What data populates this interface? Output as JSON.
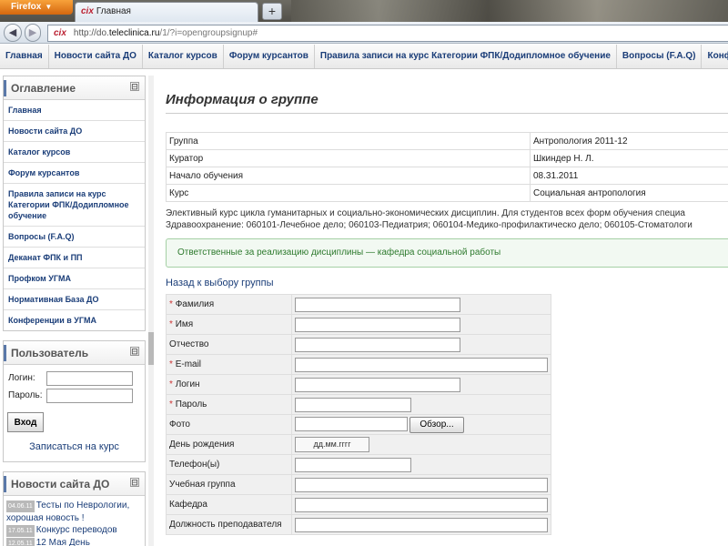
{
  "browser": {
    "app_button": "Firefox",
    "tab_logo": "cix",
    "tab_title": "Главная",
    "new_tab": "+",
    "url": {
      "scheme": "http://do.",
      "domain": "teleclinica.ru",
      "path": "/1/?i=opengroupsignup#"
    },
    "site_id": "cix",
    "back": "◀",
    "forward": "▶"
  },
  "topmenu": [
    "Главная",
    "Новости сайта ДО",
    "Каталог курсов",
    "Форум курсантов",
    "Правила записи на курс Категории ФПК/Додипломное обучение",
    "Вопросы (F.A.Q)",
    "Конференции в УГМА"
  ],
  "sidebar": {
    "toc_title": "Оглавление",
    "collapse_symbol": "⊟",
    "toc_items": [
      "Главная",
      "Новости сайта ДО",
      "Каталог курсов",
      "Форум курсантов",
      "Правила записи на курс Категории ФПК/Додипломное обучение",
      "Вопросы (F.A.Q)",
      "Деканат ФПК и ПП",
      "Профком УГМА",
      "Нормативная База ДО",
      "Конференции в УГМА"
    ],
    "user_title": "Пользователь",
    "login_label": "Логин:",
    "password_label": "Пароль:",
    "login_button": "Вход",
    "enroll_link": "Записаться на курс",
    "news_title": "Новости сайта ДО",
    "news": [
      {
        "date": "04.06.11",
        "text": "Тесты по Неврологии, хорошая новость !"
      },
      {
        "date": "17.05.11",
        "text": "Конкурс переводов"
      },
      {
        "date": "12.05.11",
        "text": "12 Мая День"
      }
    ]
  },
  "main": {
    "title": "Информация о группе",
    "info": [
      {
        "key": "Группа",
        "value": "Антропология 2011-12"
      },
      {
        "key": "Куратор",
        "value": "Шкиндер Н. Л."
      },
      {
        "key": "Начало обучения",
        "value": "08.31.2011"
      },
      {
        "key": "Курс",
        "value": "Социальная антропология"
      }
    ],
    "desc_line1": "Элективный курс цикла гуманитарных и социально-экономических дисциплин. Для студентов всех форм обучения специа",
    "desc_line2": "Здравоохранение: 060101-Лечебное дело; 060103-Педиатрия; 060104-Медико-профилактическо дело; 060105-Стоматологи",
    "notice": "Ответственные за реализацию дисциплины — кафедра социальной работы",
    "back_link": "Назад к выбору группы",
    "required_mark": "*",
    "form": {
      "surname": "Фамилия",
      "name": "Имя",
      "patronymic": "Отчество",
      "email": "E-mail",
      "login": "Логин",
      "password": "Пароль",
      "photo": "Фото",
      "browse": "Обзор...",
      "birthday": "День рождения",
      "date_placeholder": "дд.мм.гггг",
      "phone": "Телефон(ы)",
      "study_group": "Учебная группа",
      "department": "Кафедра",
      "teacher_position": "Должность преподавателя"
    }
  }
}
